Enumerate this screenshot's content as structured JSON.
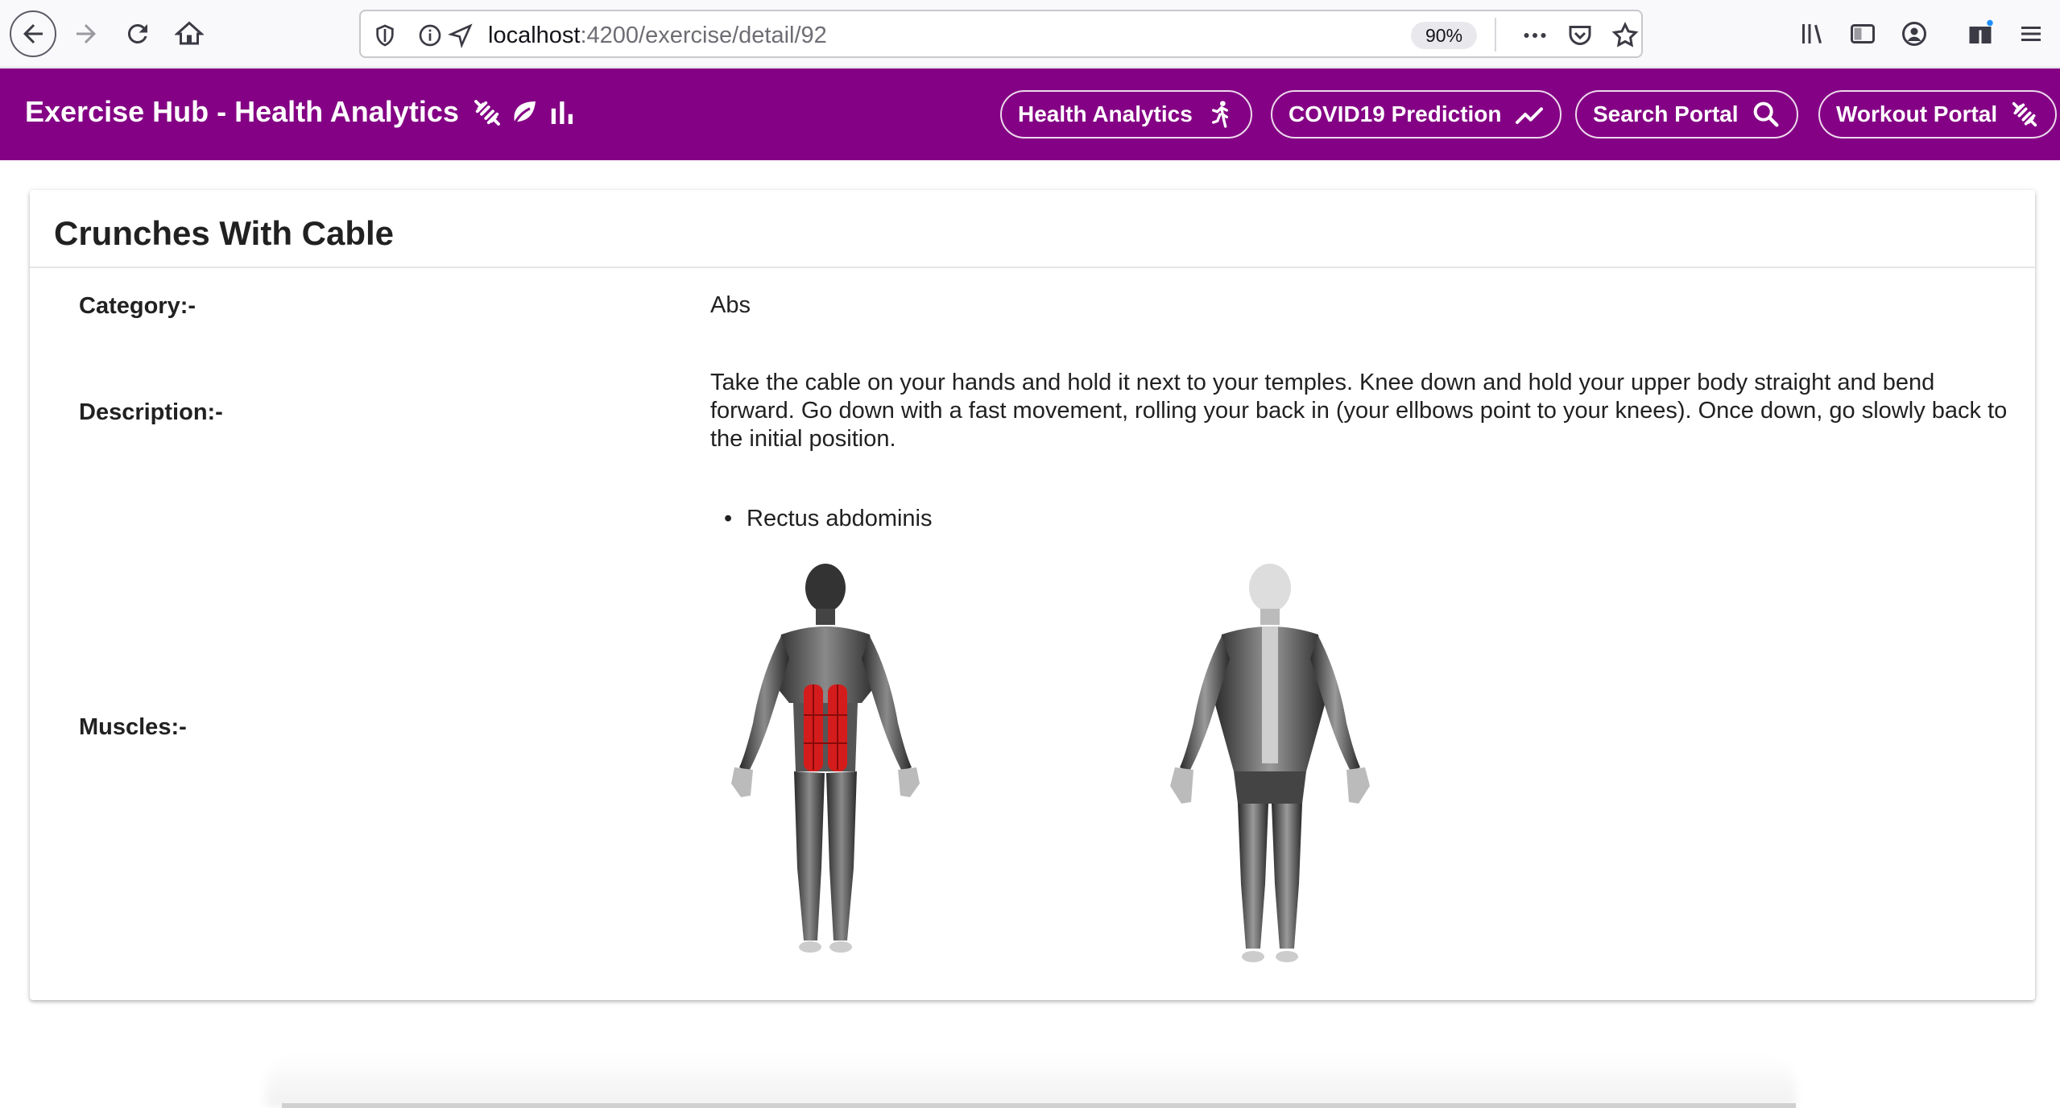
{
  "browser": {
    "url_host": "localhost",
    "url_path": ":4200/exercise/detail/92",
    "zoom": "90%"
  },
  "app": {
    "title": "Exercise Hub - Health Analytics",
    "title_icons": [
      "dumbbell-icon",
      "leaf-icon",
      "bar-chart-icon"
    ],
    "nav": [
      {
        "label": "Health Analytics",
        "icon": "running-icon"
      },
      {
        "label": "COVID19 Prediction",
        "icon": "trending-up-icon"
      },
      {
        "label": "Search Portal",
        "icon": "search-icon"
      },
      {
        "label": "Workout Portal",
        "icon": "dumbbell-icon"
      }
    ],
    "accent_color": "#840084",
    "highlight_color": "#e00000"
  },
  "exercise": {
    "name": "Crunches With Cable",
    "category_label": "Category:-",
    "category": "Abs",
    "description_label": "Description:-",
    "description": "Take the cable on your hands and hold it next to your temples. Knee down and hold your upper body straight and bend forward. Go down with a fast movement, rolling your back in (your ellbows point to your knees). Once down, go slowly back to the initial position.",
    "muscles_label": "Muscles:-",
    "muscles": [
      "Rectus abdominis"
    ]
  }
}
